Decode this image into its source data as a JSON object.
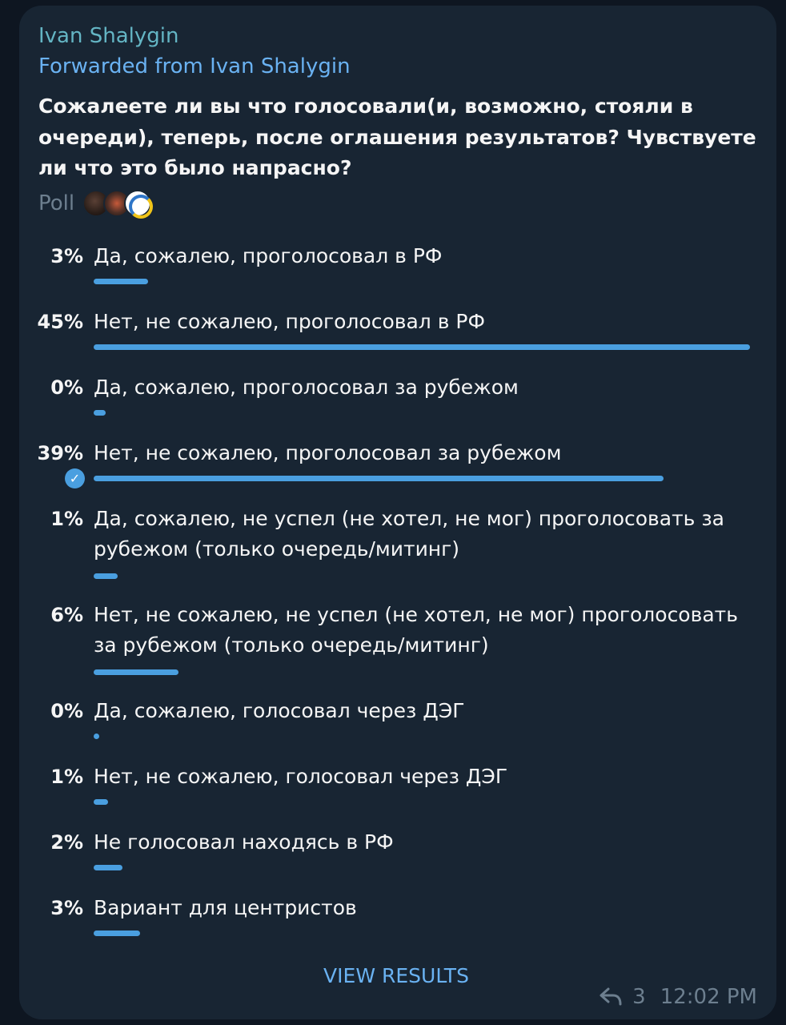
{
  "message": {
    "sender": "Ivan Shalygin",
    "forwarded": "Forwarded from Ivan Shalygin",
    "question": "Сожалеете ли вы что голосовали(и, возможно, стояли в очереди), теперь, после оглашения результатов? Чувствуете ли что это было напрасно?",
    "poll_label": "Poll",
    "view_results": "VIEW RESULTS",
    "forwards_count": "3",
    "time": "12:02 PM"
  },
  "poll": {
    "options": [
      {
        "percent": "3%",
        "text": "Да, сожалею, проголосовал в РФ",
        "fill": 0.083
      },
      {
        "percent": "45%",
        "text": "Нет, не сожалею, проголосовал в РФ",
        "fill": 1.0
      },
      {
        "percent": "0%",
        "text": "Да, сожалею, проголосовал за рубежом",
        "fill": 0.018
      },
      {
        "percent": "39%",
        "text": "Нет, не сожалею, проголосовал за рубежом",
        "fill": 0.868,
        "selected": true
      },
      {
        "percent": "1%",
        "text": "Да, сожалею, не успел (не хотел, не мог) проголосовать за рубежом (только очередь/митинг)",
        "fill": 0.037
      },
      {
        "percent": "6%",
        "text": "Нет, не сожалею, не успел (не хотел, не мог) проголосовать за рубежом (только очередь/митинг)",
        "fill": 0.129
      },
      {
        "percent": "0%",
        "text": "Да, сожалею, голосовал через ДЭГ",
        "fill": 0.009
      },
      {
        "percent": "1%",
        "text": "Нет, не сожалею, голосовал через ДЭГ",
        "fill": 0.022
      },
      {
        "percent": "2%",
        "text": "Не голосовал находясь в РФ",
        "fill": 0.044
      },
      {
        "percent": "3%",
        "text": "Вариант для центристов",
        "fill": 0.071
      }
    ]
  },
  "colors": {
    "background": "#0e1621",
    "bubble": "#182533",
    "accent": "#4a9fe0",
    "sender": "#64b5c4",
    "link": "#6ab2f2",
    "muted": "#6d7f8f",
    "text": "#f5f5f5"
  },
  "icons": {
    "check": "check-circle-icon",
    "forward": "forward-arrow-icon"
  }
}
